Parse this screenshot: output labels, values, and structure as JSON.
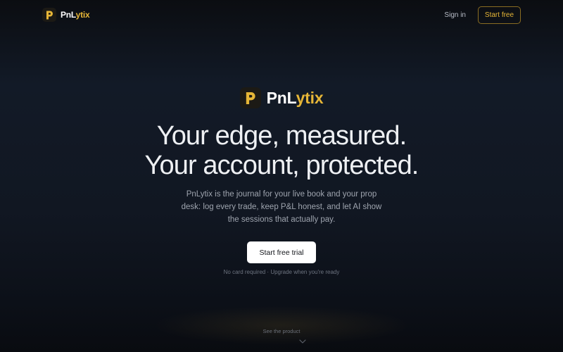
{
  "header": {
    "brand": {
      "name_main": "PnL",
      "name_accent": "ytix",
      "logo_letter": "P",
      "logo_icon": "p-logo-icon"
    },
    "sign_in_label": "Sign in",
    "start_free_label": "Start free"
  },
  "hero": {
    "brand": {
      "name_main": "PnL",
      "name_accent": "ytix",
      "logo_letter": "P",
      "logo_icon": "p-logo-icon"
    },
    "headline_lines": [
      "Your edge, measured.",
      "Your account, protected."
    ],
    "subtitle_lines": [
      "PnLytix is the journal for your live book and your prop",
      "desk: log every trade, keep P&L honest, and let AI show",
      "the sessions that actually pay."
    ],
    "cta_label": "Start free trial",
    "note": "No card required · Upgrade when you're ready"
  },
  "footer": {
    "see_product_label": "See the product",
    "chevron_icon": "chevron-down-icon"
  },
  "colors": {
    "accent": "#e6b637",
    "background": "#0f141d",
    "cta_bg": "#ffffff"
  }
}
